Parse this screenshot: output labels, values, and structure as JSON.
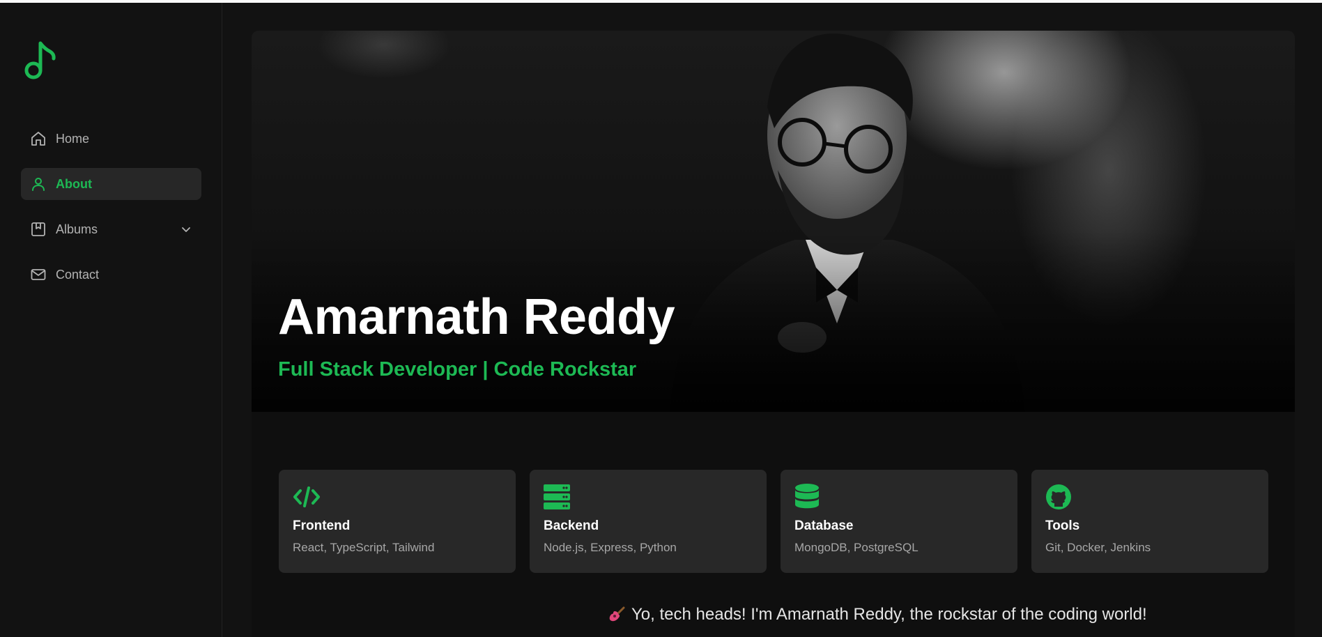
{
  "sidebar": {
    "logo_icon": "music-note-icon",
    "accent": "#1db954",
    "items": [
      {
        "label": "Home",
        "icon": "home-icon",
        "active": false
      },
      {
        "label": "About",
        "icon": "user-icon",
        "active": true
      },
      {
        "label": "Albums",
        "icon": "album-icon",
        "active": false,
        "has_dropdown": true
      },
      {
        "label": "Contact",
        "icon": "mail-icon",
        "active": false
      }
    ]
  },
  "hero": {
    "name": "Amarnath Reddy",
    "subtitle": "Full Stack Developer | Code Rockstar"
  },
  "cards": [
    {
      "title": "Frontend",
      "text": "React, TypeScript, Tailwind",
      "icon": "code-icon"
    },
    {
      "title": "Backend",
      "text": "Node.js, Express, Python",
      "icon": "server-icon"
    },
    {
      "title": "Database",
      "text": "MongoDB, PostgreSQL",
      "icon": "database-icon"
    },
    {
      "title": "Tools",
      "text": "Git, Docker, Jenkins",
      "icon": "github-icon"
    }
  ],
  "intro": {
    "icon": "guitar-icon",
    "text": "Yo, tech heads! I'm Amarnath Reddy, the rockstar of the coding world!"
  }
}
